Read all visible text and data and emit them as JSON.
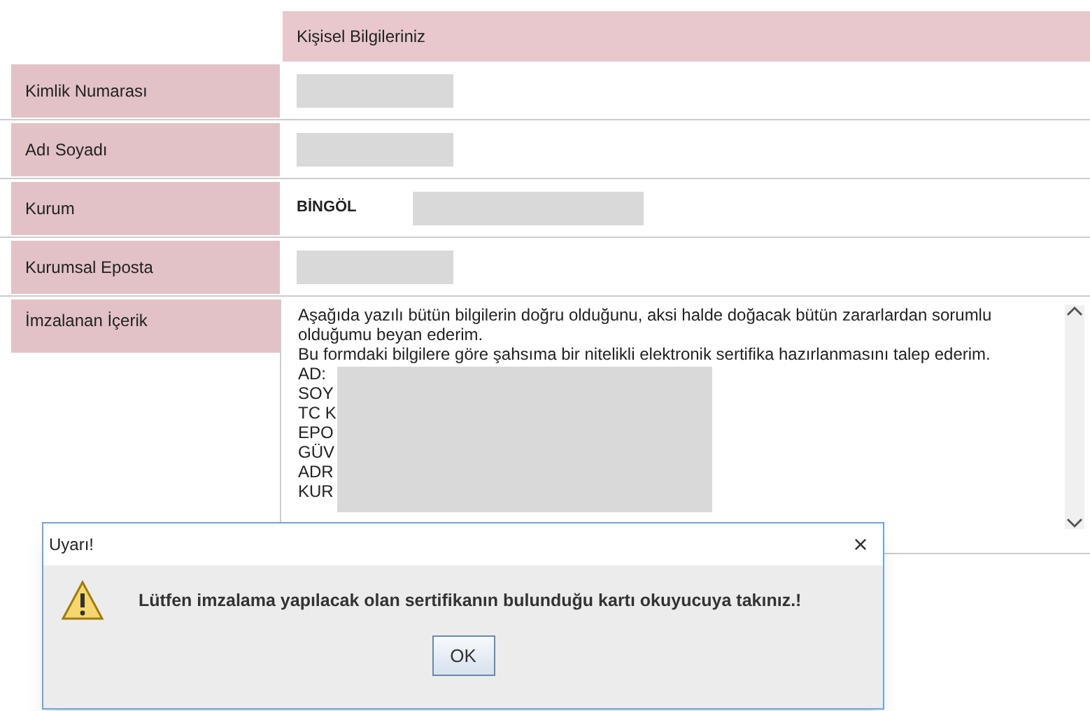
{
  "header": "Kişisel Bilgileriniz",
  "rows": [
    {
      "label": "Kimlik Numarası",
      "kind": "redacted"
    },
    {
      "label": "Adı Soyadı",
      "kind": "redacted"
    },
    {
      "label": "Kurum",
      "kind": "text",
      "value": "BİNGÖL"
    },
    {
      "label": "Kurumsal Eposta",
      "kind": "redacted"
    }
  ],
  "content": {
    "label": "İmzalanan İçerik",
    "lines": [
      "Aşağıda yazılı bütün bilgilerin doğru olduğunu, aksi halde doğacak bütün zararlardan sorumlu olduğumu beyan ederim.",
      "Bu formdaki bilgilere göre şahsıma bir nitelikli elektronik sertifika hazırlanmasını talep ederim."
    ],
    "fields": [
      "AD:",
      "SOY",
      "TC K",
      "EPO",
      "GÜV",
      "ADR",
      "KUR"
    ]
  },
  "dialog": {
    "title": "Uyarı!",
    "close": "×",
    "message": "Lütfen imzalama yapılacak olan sertifikanın bulunduğu kartı okuyucuya takınız.!",
    "button": "OK"
  }
}
